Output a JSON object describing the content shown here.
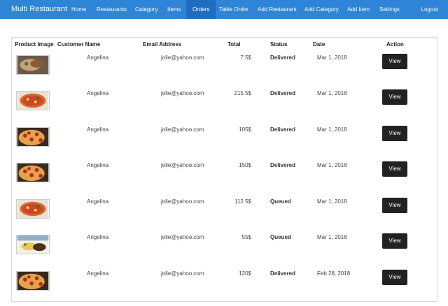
{
  "navbar": {
    "brand": "Multi Restaurant",
    "items": [
      "Home",
      "Restaurants",
      "Category",
      "Items",
      "Orders",
      "Table Order",
      "Add Restaurant",
      "Add Category",
      "Add Item",
      "Settings"
    ],
    "logout": "Logout"
  },
  "table": {
    "headers": {
      "image": "Product Image",
      "customer": "Customer Name",
      "email": "Email Address",
      "total": "Total",
      "status": "Status",
      "date": "Date",
      "action": "Action"
    },
    "rows": [
      {
        "customer": "Angelina",
        "email": "jolie@yahoo.com",
        "total": "7.5$",
        "status": "Delivered",
        "date": "Mar 1, 2018",
        "action": "View",
        "image": "roll-food-icon"
      },
      {
        "customer": "Angelina",
        "email": "jolie@yahoo.com",
        "total": "215.5$",
        "status": "Delivered",
        "date": "Mar 1, 2018",
        "action": "View",
        "image": "pizza-icon"
      },
      {
        "customer": "Angelina",
        "email": "jolie@yahoo.com",
        "total": "105$",
        "status": "Delivered",
        "date": "Mar 1, 2018",
        "action": "View",
        "image": "pepperoni-pizza-icon"
      },
      {
        "customer": "Angelina",
        "email": "jolie@yahoo.com",
        "total": "150$",
        "status": "Delivered",
        "date": "Mar 1, 2018",
        "action": "View",
        "image": "pepperoni-pizza-icon"
      },
      {
        "customer": "Angelina",
        "email": "jolie@yahoo.com",
        "total": "112.5$",
        "status": "Queued",
        "date": "Mar 1, 2018",
        "action": "View",
        "image": "pizza-icon"
      },
      {
        "customer": "Angelina",
        "email": "jolie@yahoo.com",
        "total": "55$",
        "status": "Queued",
        "date": "Mar 1, 2018",
        "action": "View",
        "image": "steak-plate-icon"
      },
      {
        "customer": "Angelina",
        "email": "jolie@yahoo.com",
        "total": "120$",
        "status": "Delivered",
        "date": "Feb 28, 2018",
        "action": "View",
        "image": "pepperoni-pizza-icon"
      }
    ]
  },
  "colors": {
    "navbar": "#2e84d6",
    "nav_active": "#1f6dbf",
    "button": "#222222"
  }
}
